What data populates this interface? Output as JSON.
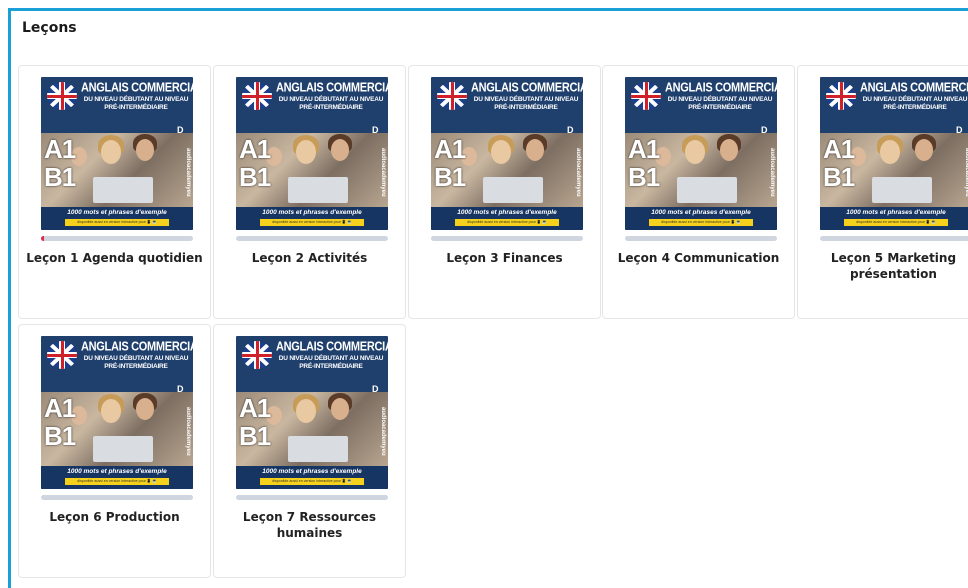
{
  "page": {
    "title": "Leçons"
  },
  "cover": {
    "title_line1": "ANGLAIS COMMERCIAL",
    "title_line2": "DU NIVEAU DÉBUTANT AU NIVEAU PRÉ-INTERMÉDIAIRE",
    "level_a": "A1",
    "level_b": "B1",
    "brand": "audioacademyeu",
    "brand_logo": "D",
    "footer_main": "1000 mots et phrases d'exemple",
    "footer_badge": "disponible aussi en version interactive pour 📱 💻",
    "flag_icon": "uk-flag-icon"
  },
  "lessons": [
    {
      "label": "Leçon 1 Agenda quotidien",
      "progress": 0.02
    },
    {
      "label": "Leçon 2 Activités",
      "progress": 0
    },
    {
      "label": "Leçon 3 Finances",
      "progress": 0
    },
    {
      "label": "Leçon 4 Communication",
      "progress": 0
    },
    {
      "label": "Leçon 5 Marketing présentation",
      "progress": 0
    },
    {
      "label": "Leçon 6 Production",
      "progress": 0
    },
    {
      "label": "Leçon 7 Ressources humaines",
      "progress": 0
    }
  ],
  "colors": {
    "accent_border": "#1a9fd6",
    "cover_bg": "#1f3f6d",
    "progress_track": "#cfd6df",
    "progress_fill": "#e0294c"
  }
}
